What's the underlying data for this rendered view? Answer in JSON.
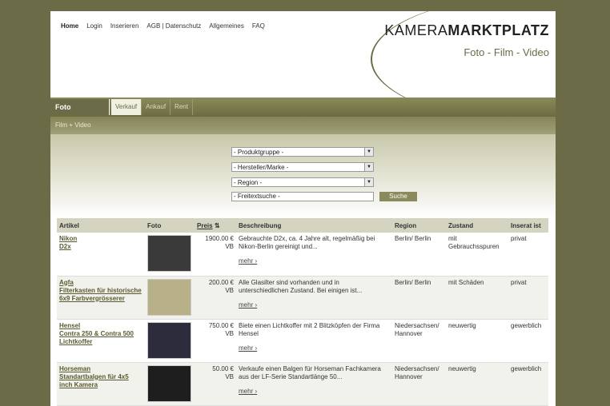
{
  "nav": {
    "items": [
      "Home",
      "Login",
      "Inserieren",
      "AGB | Datenschutz",
      "Allgemeines",
      "FAQ"
    ],
    "active": "Home"
  },
  "brand": {
    "logo_a": "KAMERA",
    "logo_b": "MARKTPLATZ",
    "tagline": "Foto - Film - Video"
  },
  "tabs": {
    "main": "Foto",
    "sub": [
      "Verkauf",
      "Ankauf",
      "Rent"
    ],
    "breadcrumb": "Film + Video"
  },
  "search": {
    "produktgruppe": "- Produktgruppe -",
    "hersteller": "- Hersteller/Marke -",
    "region": "- Region -",
    "freitext_placeholder": "- Freitextsuche -",
    "button": "Suche"
  },
  "table": {
    "headers": {
      "artikel": "Artikel",
      "foto": "Foto",
      "preis": "Preis",
      "sort_icon": "⇅",
      "beschreibung": "Beschreibung",
      "region": "Region",
      "zustand": "Zustand",
      "inserat": "Inserat ist"
    },
    "mehr": "mehr ›",
    "rows": [
      {
        "title1": "Nikon",
        "title2": "D2x",
        "price": "1900.00 €",
        "vb": "VB",
        "desc": "Gebrauchte D2x, ca. 4 Jahre alt, regelmäßig bei Nikon-Berlin gereinigt und...",
        "region": "Berlin/ Berlin",
        "zustand": "mit Gebrauchsspuren",
        "inserat": "privat",
        "thumb_color": "#3a3a3a"
      },
      {
        "title1": "Agfa",
        "title2": "Filterkasten für historische 6x9 Farbvergrösserer",
        "price": "200.00 €",
        "vb": "VB",
        "desc": "Alle Glasilter sind vorhanden und in unterschiedlichen Zustand. Bei einigen ist...",
        "region": "Berlin/ Berlin",
        "zustand": "mit Schäden",
        "inserat": "privat",
        "thumb_color": "#b8b088"
      },
      {
        "title1": "Hensel",
        "title2": "Contra 250 & Contra 500 Lichtkoffer",
        "price": "750.00 €",
        "vb": "VB",
        "desc": "Biete einen Lichtkoffer mit 2 Blitzköpfen der Firma Hensel",
        "region": "Niedersachsen/ Hannover",
        "zustand": "neuwertig",
        "inserat": "gewerblich",
        "thumb_color": "#2c2c3c"
      },
      {
        "title1": "Horseman",
        "title2": "Standartbalgen für 4x5 inch Kamera",
        "price": "50.00 €",
        "vb": "VB",
        "desc": "Verkaufe einen Balgen für Horseman Fachkamera aus der LF-Serie Standartlänge 50...",
        "region": "Niedersachsen/ Hannover",
        "zustand": "neuwertig",
        "inserat": "gewerblich",
        "thumb_color": "#1e1e1e"
      }
    ]
  }
}
